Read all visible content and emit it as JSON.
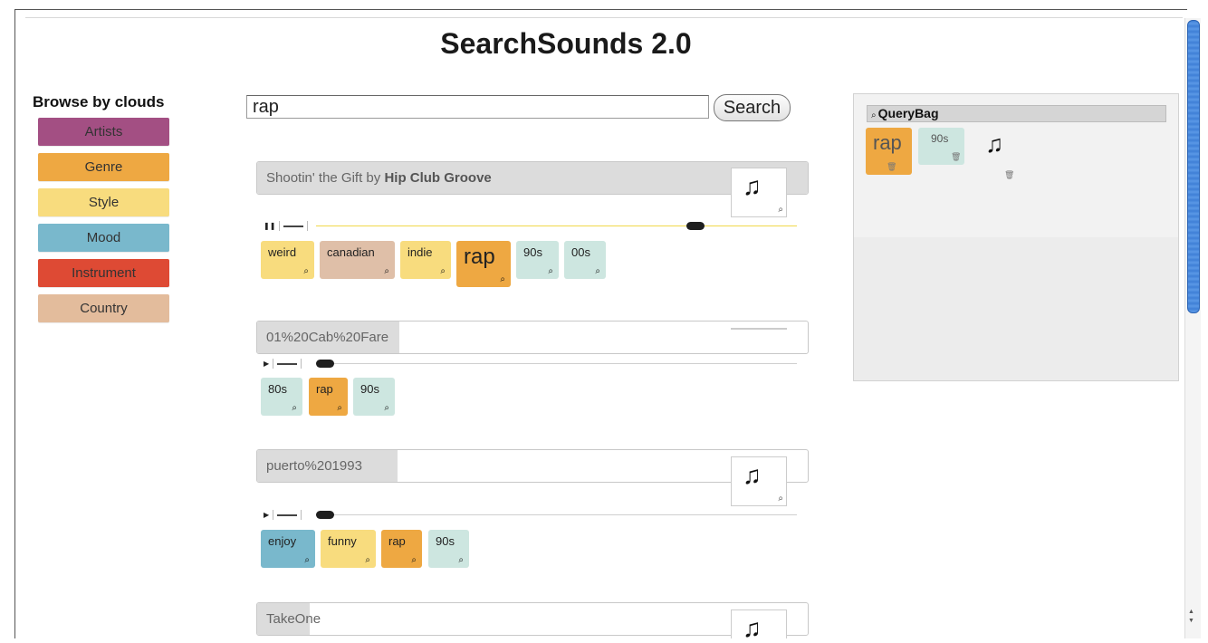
{
  "app": {
    "title": "SearchSounds 2.0"
  },
  "browse": {
    "title": "Browse by clouds",
    "clouds": [
      {
        "label": "Artists",
        "color": "#a34f83"
      },
      {
        "label": "Genre",
        "color": "#eea842"
      },
      {
        "label": "Style",
        "color": "#f8dc7e"
      },
      {
        "label": "Mood",
        "color": "#79b8cc"
      },
      {
        "label": "Instrument",
        "color": "#de4a34"
      },
      {
        "label": "Country",
        "color": "#e3bc9c"
      }
    ]
  },
  "search": {
    "value": "rap",
    "button_label": "Search"
  },
  "results": [
    {
      "title_prefix": "Shootin' the Gift by ",
      "artist": "Hip Club Groove",
      "play_icon": "pause-icon",
      "progress": 0.8,
      "tags": [
        {
          "label": "weird",
          "color": "#f8dc7e"
        },
        {
          "label": "canadian",
          "color": "#dfbfa8"
        },
        {
          "label": "indie",
          "color": "#f8dc7e"
        },
        {
          "label": "rap",
          "color": "#eea842",
          "big": true
        },
        {
          "label": "90s",
          "color": "#cde6e0"
        },
        {
          "label": "00s",
          "color": "#cde6e0"
        }
      ]
    },
    {
      "title_prefix": "01%20Cab%20Fare",
      "artist": "",
      "play_icon": "play-icon",
      "progress": 0.0,
      "tags": [
        {
          "label": "80s",
          "color": "#cde6e0"
        },
        {
          "label": "rap",
          "color": "#eea842"
        },
        {
          "label": "90s",
          "color": "#cde6e0"
        }
      ]
    },
    {
      "title_prefix": "puerto%201993",
      "artist": "",
      "play_icon": "play-icon",
      "progress": 0.0,
      "tags": [
        {
          "label": "enjoy",
          "color": "#79b8cc"
        },
        {
          "label": "funny",
          "color": "#f8dc7e"
        },
        {
          "label": "rap",
          "color": "#eea842"
        },
        {
          "label": "90s",
          "color": "#cde6e0"
        }
      ]
    },
    {
      "title_prefix": "TakeOne",
      "artist": "",
      "play_icon": "play-icon",
      "progress": 0.0,
      "tags": []
    }
  ],
  "querybag": {
    "title": "QueryBag",
    "items": [
      {
        "label": "rap",
        "color": "#eea842"
      },
      {
        "label": "90s",
        "color": "#cde6e0"
      }
    ]
  },
  "glyphs": {
    "note": "♫",
    "magnifier": "⌕",
    "trash": "🗑",
    "pause": "❚❚",
    "play": "▶"
  }
}
